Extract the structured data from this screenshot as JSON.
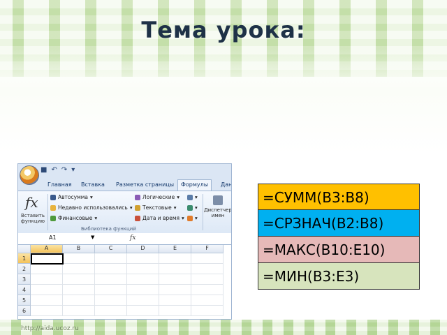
{
  "slide": {
    "title": "Тема урока:",
    "footer_url": "http://aida.ucoz.ru"
  },
  "excel": {
    "ribbon_tabs": [
      "Главная",
      "Вставка",
      "Разметка страницы",
      "Формулы",
      "Дан"
    ],
    "active_tab": "Формулы",
    "insert_function_label": "Вставить функцию",
    "library_items": [
      {
        "label": "Автосумма",
        "icon": "sigma-icon"
      },
      {
        "label": "Недавно использовались",
        "icon": "star-icon"
      },
      {
        "label": "Финансовые",
        "icon": "finance-icon"
      },
      {
        "label": "Логические",
        "icon": "logic-icon"
      },
      {
        "label": "Текстовые",
        "icon": "text-icon"
      },
      {
        "label": "Дата и время",
        "icon": "calendar-icon"
      }
    ],
    "library_group_label": "Библиотека функций",
    "name_manager_label": "Диспетчер имен",
    "name_box_value": "A1",
    "fx_label": "fx",
    "columns": [
      "A",
      "B",
      "C",
      "D",
      "E",
      "F"
    ],
    "rows": [
      "1",
      "2",
      "3",
      "4",
      "5",
      "6"
    ],
    "selected_cell": "A1"
  },
  "formulas": [
    {
      "text": "=СУММ(B3:B8)",
      "color": "#ffc000"
    },
    {
      "text": "=СРЗНАЧ(B2:B8)",
      "color": "#00b0f0"
    },
    {
      "text": "=МАКС(B10:E10)",
      "color": "#e6b9b8"
    },
    {
      "text": "=МИН(B3:E3)",
      "color": "#d7e4bd"
    }
  ]
}
